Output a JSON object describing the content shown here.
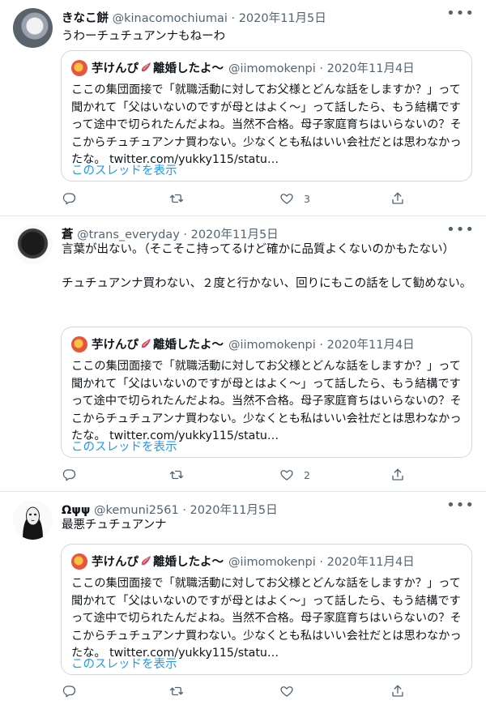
{
  "quoted": {
    "name": "芋けんぴ",
    "name_suffix": "離婚したよ〜",
    "handle": "@iimomokenpi",
    "separator": "·",
    "date": "2020年11月4日",
    "text": "ここの集団面接で「就職活動に対してお父様とどんな話をしますか？」って聞かれて「父はいないのですが母とはよく〜」って話したら、もう結構ですって途中で切られたんだよね。当然不合格。母子家庭育ちはいらないの？そこからチュチュアンナ買わない。少なくとも私はいい会社だとは思わなかったな。 twitter.com/yukky115/statu…",
    "thread_link": "このスレッドを表示"
  },
  "tweets": [
    {
      "name": "きなこ餅",
      "handle": "@kinacomochiumai",
      "separator": "·",
      "date": "2020年11月5日",
      "text": "うわーチュチュアンナもねーわ",
      "likes": "3"
    },
    {
      "name": "蒼",
      "handle": "@trans_everyday",
      "separator": "·",
      "date": "2020年11月5日",
      "text": "言葉が出ない。（そこそこ持ってるけど確かに品質よくないのかもたない）\n\nチュチュアンナ買わない、２度と行かない、回りにもこの話をして勧めない。",
      "likes": "2"
    },
    {
      "name": "Ωψψ",
      "handle": "@kemuni2561",
      "separator": "·",
      "date": "2020年11月5日",
      "text": "最悪チュチュアンナ",
      "likes": ""
    }
  ],
  "icons": {
    "more": "more-icon",
    "reply": "reply-icon",
    "retweet": "retweet-icon",
    "like": "heart-icon",
    "share": "share-icon"
  },
  "colors": {
    "link": "#1d9bf0",
    "secondary_text": "#536471",
    "border": "#cfd9de"
  }
}
